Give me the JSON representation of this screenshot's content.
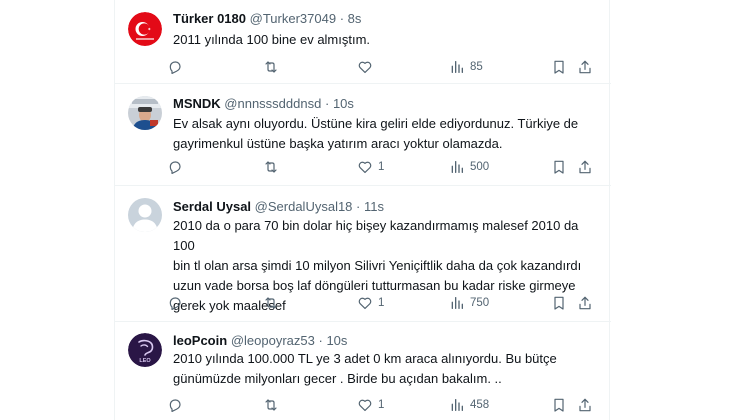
{
  "tweets": [
    {
      "name": "Türker 0180",
      "handle": "@Turker37049",
      "dot": "·",
      "time": "8s",
      "lines": [
        "2011 yılında 100 bine ev almıştım."
      ],
      "replies": "",
      "retweets": "",
      "likes": "",
      "views": "85",
      "avatar": "turkish-flag"
    },
    {
      "name": "MSNDK",
      "handle": "@nnnsssdddnsd",
      "dot": "·",
      "time": "10s",
      "lines": [
        "Ev alsak aynı oluyordu. Üstüne kira geliri elde ediyordunuz. Türkiye de",
        "gayrimenkul üstüne başka yatırım aracı yoktur olamazda."
      ],
      "replies": "",
      "retweets": "",
      "likes": "1",
      "views": "500",
      "avatar": "photo"
    },
    {
      "name": "Serdal Uysal",
      "handle": "@SerdalUysal18",
      "dot": "·",
      "time": "11s",
      "lines": [
        "2010 da o para 70 bin dolar hiç bişey kazandırmamış malesef 2010 da 100",
        "bin tl olan arsa şimdi 10 milyon Silivri Yeniçiftlik daha da çok kazandırdı",
        "uzun vade borsa boş laf döngüleri tutturmasan bu kadar riske girmeye",
        "gerek yok maalesef"
      ],
      "replies": "",
      "retweets": "",
      "likes": "1",
      "views": "750",
      "avatar": "default-user"
    },
    {
      "name": "leoPcoin",
      "handle": "@leopoyraz53",
      "dot": "·",
      "time": "10s",
      "lines": [
        "2010 yılında 100.000 TL ye 3 adet 0 km araca alınıyordu.  Bu bütçe",
        "günümüzde milyonları gecer . Birde bu açıdan bakalım. .."
      ],
      "replies": "",
      "retweets": "",
      "likes": "1",
      "views": "458",
      "avatar": "leo-logo",
      "avatar_text": "LEO"
    }
  ],
  "colors": {
    "text": "#0f1419",
    "secondary": "#536471",
    "border": "#eff3f4",
    "flag_red": "#e30a17",
    "leo_purple": "#2a1646"
  }
}
